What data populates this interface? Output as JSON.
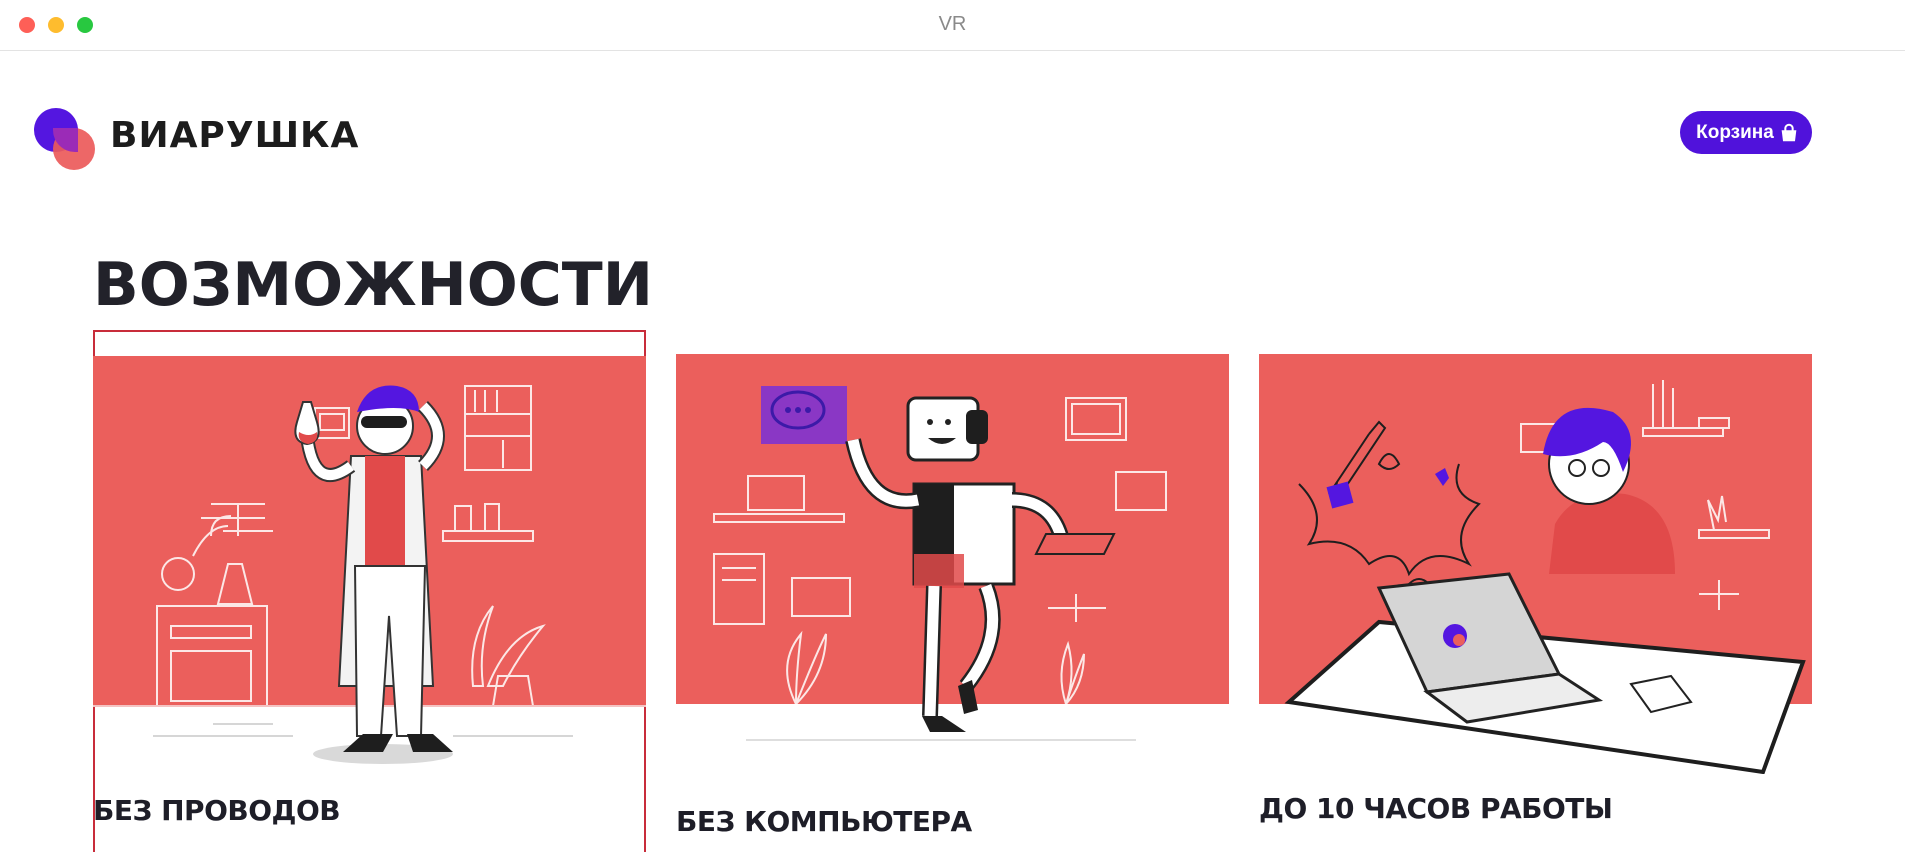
{
  "window": {
    "title": "VR"
  },
  "header": {
    "brand": "ВИАРУШКА",
    "cart_label": "Корзина",
    "cart_icon": "shopping-bag-icon"
  },
  "features": {
    "title": "ВОЗМОЖНОСТИ",
    "cards": [
      {
        "label": "БЕЗ ПРОВОДОВ",
        "illustration": "scientist-illustration"
      },
      {
        "label": "БЕЗ КОМПЬЮТЕРА",
        "illustration": "robot-illustration"
      },
      {
        "label": "ДО 10 ЧАСОВ РАБОТЫ",
        "illustration": "laptop-worker-illustration"
      }
    ]
  },
  "colors": {
    "accent": "#5012db",
    "coral": "#eb5f5c",
    "selected_border": "#c82c3a"
  }
}
